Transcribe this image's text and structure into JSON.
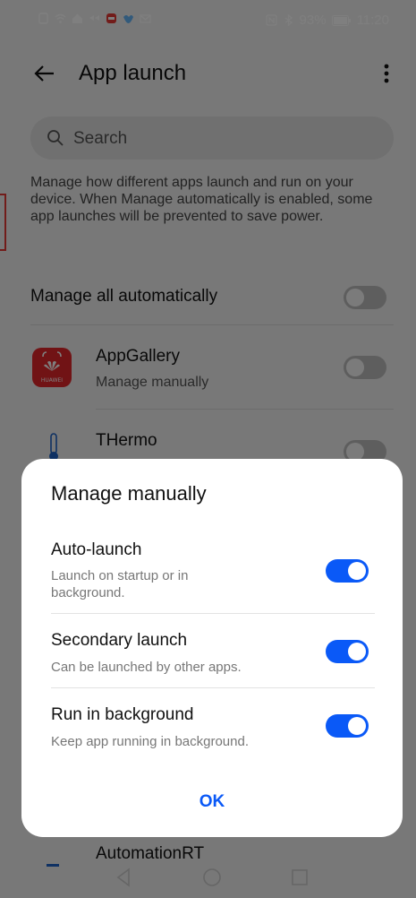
{
  "status_bar": {
    "battery": "93%",
    "time": "11:20"
  },
  "app_bar": {
    "title": "App launch"
  },
  "search": {
    "placeholder": "Search"
  },
  "description": "Manage how different apps launch and run on your device. When Manage automatically is enabled, some app launches will be prevented to save power.",
  "manage_all": {
    "label": "Manage all automatically",
    "enabled": false
  },
  "apps": [
    {
      "name": "AppGallery",
      "status": "Manage manually",
      "icon": "huawei-appgallery-icon",
      "brand_text": "HUAWEI",
      "enabled": false
    },
    {
      "name": "THermo",
      "icon": "thermometer-icon",
      "enabled": false
    },
    {
      "name": "AutomationRT",
      "icon": "app-icon"
    }
  ],
  "dialog": {
    "title": "Manage manually",
    "options": [
      {
        "title": "Auto-launch",
        "subtitle": "Launch on startup or in background.",
        "enabled": true
      },
      {
        "title": "Secondary launch",
        "subtitle": "Can be launched by other apps.",
        "enabled": true
      },
      {
        "title": "Run in background",
        "subtitle": "Keep app running in background.",
        "enabled": true
      }
    ],
    "ok_label": "OK"
  },
  "colors": {
    "accent": "#0a59f7",
    "background": "#f1f1f1",
    "dialog": "#ffffff"
  }
}
